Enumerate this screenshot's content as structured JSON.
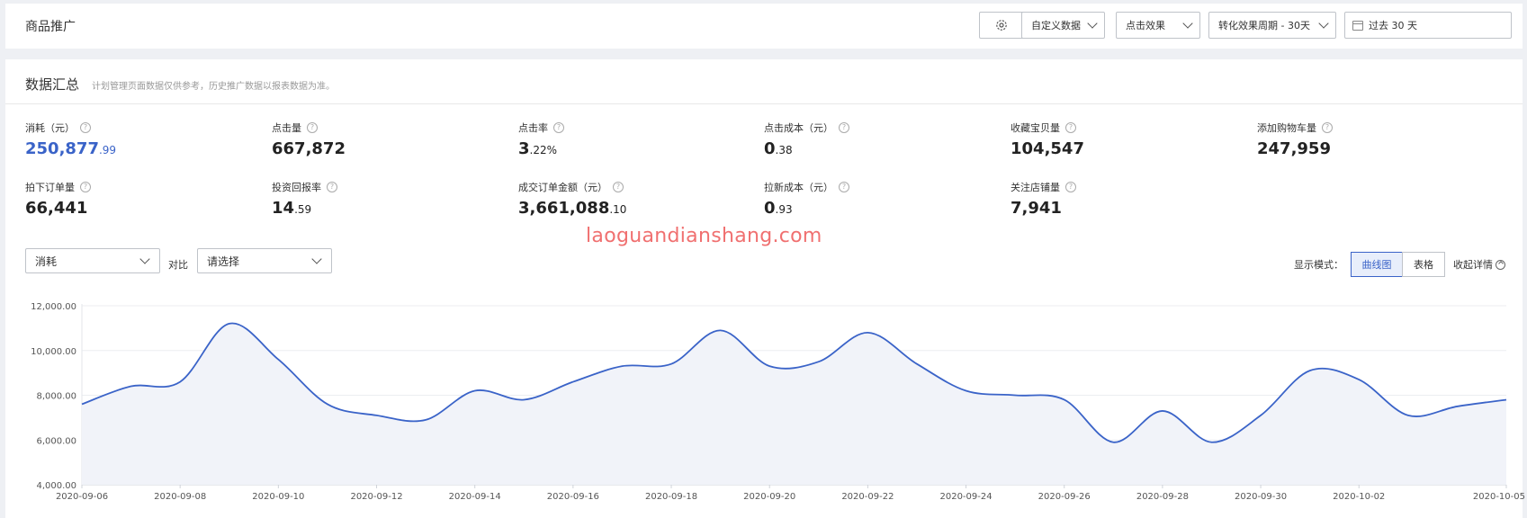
{
  "header": {
    "title": "商品推广",
    "custom_data": "自定义数据",
    "click_effect": "点击效果",
    "conversion_period": "转化效果周期 - 30天",
    "date_range": "过去 30 天"
  },
  "summary": {
    "title": "数据汇总",
    "hint": "计划管理页面数据仅供参考，历史推广数据以报表数据为准。"
  },
  "metrics": [
    {
      "label": "消耗（元）",
      "int": "250,877",
      "dec": ".99"
    },
    {
      "label": "点击量",
      "int": "667,872",
      "dec": ""
    },
    {
      "label": "点击率",
      "int": "3",
      "dec": ".22%"
    },
    {
      "label": "点击成本（元）",
      "int": "0",
      "dec": ".38"
    },
    {
      "label": "收藏宝贝量",
      "int": "104,547",
      "dec": ""
    },
    {
      "label": "添加购物车量",
      "int": "247,959",
      "dec": ""
    },
    {
      "label": "拍下订单量",
      "int": "66,441",
      "dec": ""
    },
    {
      "label": "投资回报率",
      "int": "14",
      "dec": ".59"
    },
    {
      "label": "成交订单金额（元）",
      "int": "3,661,088",
      "dec": ".10"
    },
    {
      "label": "拉新成本（元）",
      "int": "0",
      "dec": ".93"
    },
    {
      "label": "关注店铺量",
      "int": "7,941",
      "dec": ""
    }
  ],
  "controls": {
    "metric_select": "消耗",
    "compare_label": "对比",
    "compare_select": "请选择",
    "display_mode_label": "显示模式：",
    "mode_curve": "曲线图",
    "mode_table": "表格",
    "collapse": "收起详情"
  },
  "watermark": "laoguandianshang.com",
  "colors": {
    "line": "#3a63c8",
    "fill": "#f1f3f9",
    "accent": "#3a63c8",
    "watermark": "#f07070"
  },
  "chart_data": {
    "type": "area",
    "ylim": [
      4000,
      12000
    ],
    "yticks": [
      "4,000.00",
      "6,000.00",
      "8,000.00",
      "10,000.00",
      "12,000.00"
    ],
    "ytick_values": [
      4000,
      6000,
      8000,
      10000,
      12000
    ],
    "x": [
      "2020-09-06",
      "2020-09-07",
      "2020-09-08",
      "2020-09-09",
      "2020-09-10",
      "2020-09-11",
      "2020-09-12",
      "2020-09-13",
      "2020-09-14",
      "2020-09-15",
      "2020-09-16",
      "2020-09-17",
      "2020-09-18",
      "2020-09-19",
      "2020-09-20",
      "2020-09-21",
      "2020-09-22",
      "2020-09-23",
      "2020-09-24",
      "2020-09-25",
      "2020-09-26",
      "2020-09-27",
      "2020-09-28",
      "2020-09-29",
      "2020-09-30",
      "2020-10-01",
      "2020-10-02",
      "2020-10-03",
      "2020-10-04",
      "2020-10-05"
    ],
    "values": [
      7600,
      8400,
      8600,
      11200,
      9600,
      7600,
      7100,
      6900,
      8200,
      7800,
      8600,
      9300,
      9400,
      10900,
      9300,
      9500,
      10800,
      9400,
      8200,
      8000,
      7800,
      5900,
      7300,
      5900,
      7100,
      9100,
      8700,
      7100,
      7500,
      7800
    ],
    "xlabels": [
      "2020-09-06",
      "2020-09-08",
      "2020-09-10",
      "2020-09-12",
      "2020-09-14",
      "2020-09-16",
      "2020-09-18",
      "2020-09-20",
      "2020-09-22",
      "2020-09-24",
      "2020-09-26",
      "2020-09-28",
      "2020-09-30",
      "2020-10-02",
      "2020-10-05"
    ],
    "grid": true
  }
}
